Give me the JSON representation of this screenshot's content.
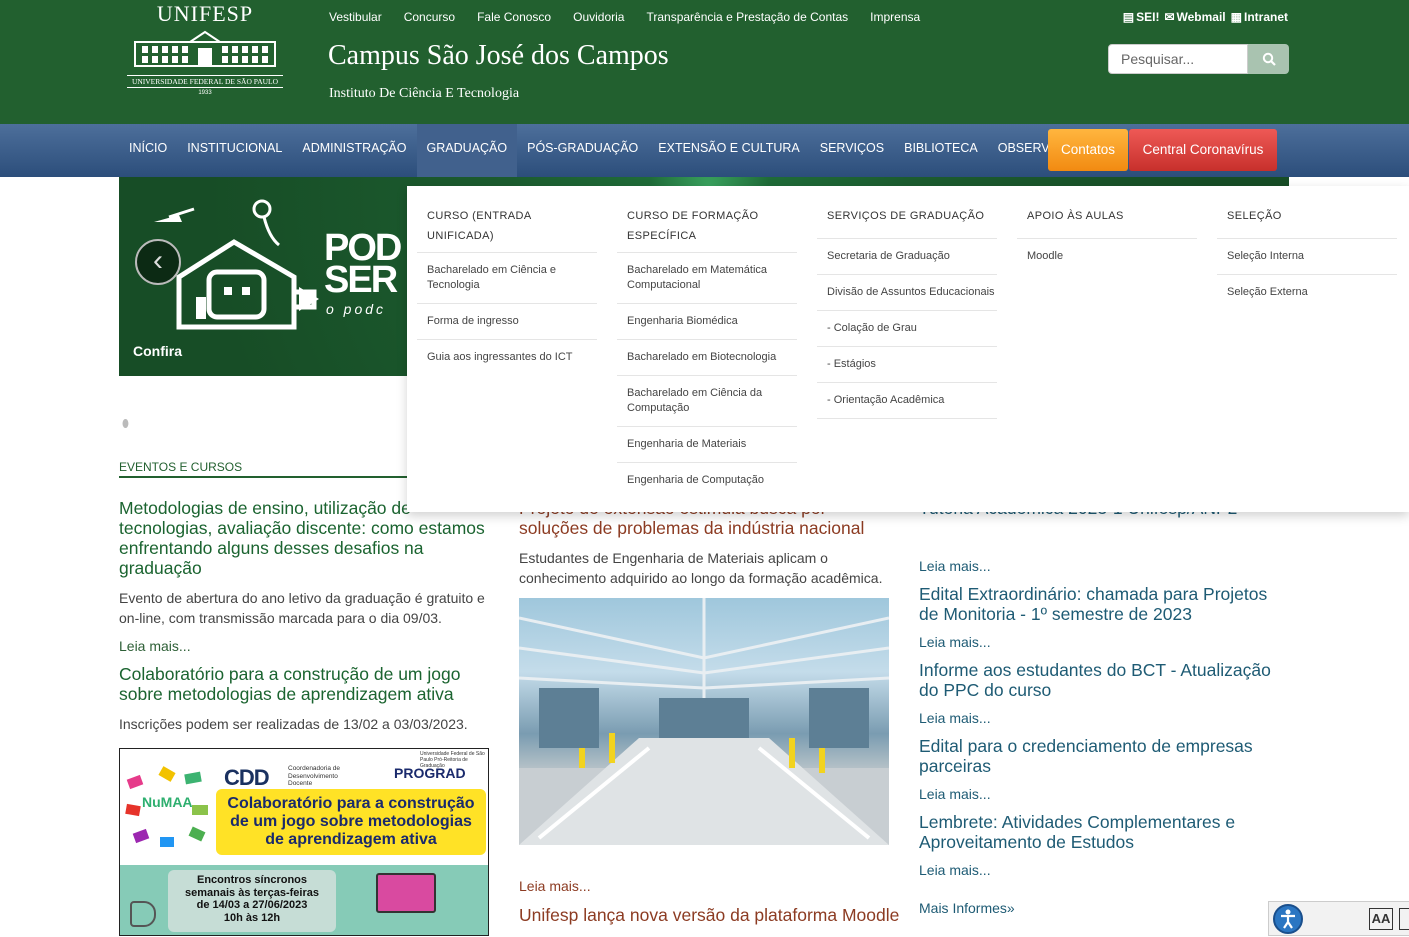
{
  "header": {
    "logo": {
      "title": "UNIFESP",
      "subtitle": "UNIVERSIDADE FEDERAL DE SÃO PAULO",
      "year": "1933"
    },
    "top_links": [
      "Vestibular",
      "Concurso",
      "Fale Conosco",
      "Ouvidoria",
      "Transparência e Prestação de Contas",
      "Imprensa"
    ],
    "campus_title": "Campus São José dos Campos",
    "institute": "Instituto De Ciência E Tecnologia",
    "util_links": {
      "sei": "SEI!",
      "webmail": "Webmail",
      "intranet": "Intranet"
    },
    "search": {
      "placeholder": "Pesquisar..."
    }
  },
  "nav": {
    "items": [
      "INÍCIO",
      "INSTITUCIONAL",
      "ADMINISTRAÇÃO",
      "GRADUAÇÃO",
      "PÓS-GRADUAÇÃO",
      "EXTENSÃO E CULTURA",
      "SERVIÇOS",
      "BIBLIOTECA",
      "OBSERVATÓRIO"
    ],
    "active": "GRADUAÇÃO",
    "contatos": "Contatos",
    "corona": "Central Coronavírus"
  },
  "banner": {
    "podcast_line1": "POD",
    "podcast_line2": "SER",
    "podcast_letter": "C",
    "podcast_sub": "o podc",
    "caption": "Confira",
    "prev": "‹"
  },
  "dropdown": {
    "columns": [
      {
        "heading": "CURSO (ENTRADA UNIFICADA)",
        "items": [
          "Bacharelado em Ciência e Tecnologia",
          "Forma de ingresso",
          "Guia aos ingressantes do ICT"
        ]
      },
      {
        "heading": "CURSO DE FORMAÇÃO ESPECÍFICA",
        "items": [
          "Bacharelado em Matemática Computacional",
          "Engenharia Biomédica",
          "Bacharelado em Biotecnologia",
          "Bacharelado em Ciência da Computação",
          "Engenharia de Materiais",
          "Engenharia de Computação"
        ]
      },
      {
        "heading": "SERVIÇOS DE GRADUAÇÃO",
        "items": [
          "Secretaria de Graduação",
          "Divisão de Assuntos Educacionais",
          "- Colação de Grau",
          "- Estágios",
          "- Orientação Acadêmica"
        ]
      },
      {
        "heading": "APOIO ÀS AULAS",
        "items": [
          "Moodle"
        ]
      },
      {
        "heading": "SELEÇÃO",
        "items": [
          "Seleção Interna",
          "Seleção Externa"
        ]
      }
    ]
  },
  "events": {
    "section_title": "EVENTOS E CURSOS",
    "items": [
      {
        "title": "Metodologias de ensino, utilização de tecnologias, avaliação discente: como estamos enfrentando alguns desses desafios na graduação",
        "excerpt": "Evento de abertura do ano letivo da graduação é gratuito e on-line, com transmissão marcada para o dia 09/03.",
        "more": "Leia mais..."
      },
      {
        "title": "Colaboratório para a construção de um jogo sobre metodologias de aprendizagem ativa",
        "excerpt": "Inscrições podem ser realizadas de 13/02 a 03/03/2023."
      }
    ]
  },
  "promo": {
    "numaa": "NuMAA",
    "cdd": "CDD",
    "cdd_text": "Coordenadoria de Desenvolvimento Docente",
    "prograd_small": "Universidade Federal de São Paulo Pró-Reitoria de Graduação",
    "prograd": "PROGRAD",
    "headline": [
      "Colaboratório para a construção",
      "de um jogo sobre metodologias",
      "de aprendizagem ativa"
    ],
    "schedule": [
      "Encontros síncronos",
      "semanais às terças-feiras",
      "de 14/03 a 27/06/2023",
      "10h às 12h"
    ]
  },
  "news_mid": {
    "title_partial": "Projeto de extensão estimula busca por soluções de problemas da indústria nacional",
    "excerpt": "Estudantes de Engenharia de Materiais aplicam o conhecimento adquirido ao longo da formação acadêmica.",
    "more": "Leia mais...",
    "next_title": "Unifesp lança nova versão da plataforma Moodle"
  },
  "news_right": {
    "first_partial": "Tutoria Acadêmica 2023-1 Unifesp/ANP2",
    "items": [
      {
        "title": "Edital Extraordinário: chamada para Projetos de Monitoria - 1º semestre de 2023"
      },
      {
        "title": "Informe aos estudantes do BCT - Atualização do PPC do curso"
      },
      {
        "title": "Edital para o credenciamento de empresas parceiras"
      },
      {
        "title": "Lembrete: Atividades Complementares e Aproveitamento de Estudos"
      }
    ],
    "more": "Leia mais...",
    "all": "Mais Informes»"
  },
  "a11y": {
    "font_label": "AA"
  }
}
